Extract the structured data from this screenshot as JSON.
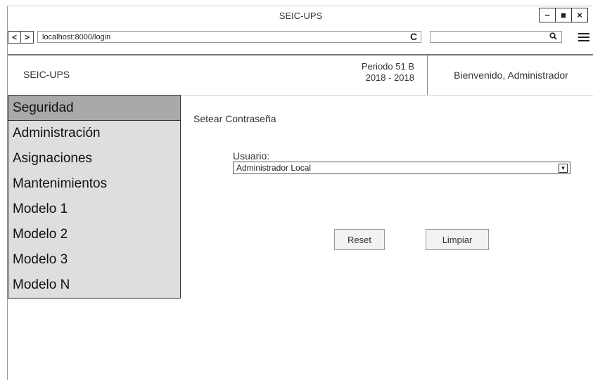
{
  "window": {
    "title": "SEIC-UPS",
    "controls": {
      "minimize": "−",
      "maximize": "■",
      "close": "×"
    }
  },
  "browser": {
    "back": "<",
    "forward": ">",
    "url": "localhost:8000/login",
    "reload": "C",
    "search_placeholder": "",
    "search_icon": "search-icon",
    "menu_icon": "hamburger-icon"
  },
  "header": {
    "brand": "SEIC-UPS",
    "periodo_line1": "Periodo 51 B",
    "periodo_line2": "2018 - 2018",
    "welcome": "Bienvenido, Administrador"
  },
  "sidebar": {
    "items": [
      {
        "label": "Seguridad",
        "active": true
      },
      {
        "label": "Administración"
      },
      {
        "label": "Asignaciones"
      },
      {
        "label": "Mantenimientos"
      },
      {
        "label": "Modelo 1"
      },
      {
        "label": "Modelo 2"
      },
      {
        "label": "Modelo 3"
      },
      {
        "label": "Modelo N"
      }
    ]
  },
  "main": {
    "title": "Setear Contraseña",
    "usuario_label": "Usuario:",
    "usuario_value": "Administrador Local",
    "reset_label": "Reset",
    "limpiar_label": "Limpiar"
  }
}
